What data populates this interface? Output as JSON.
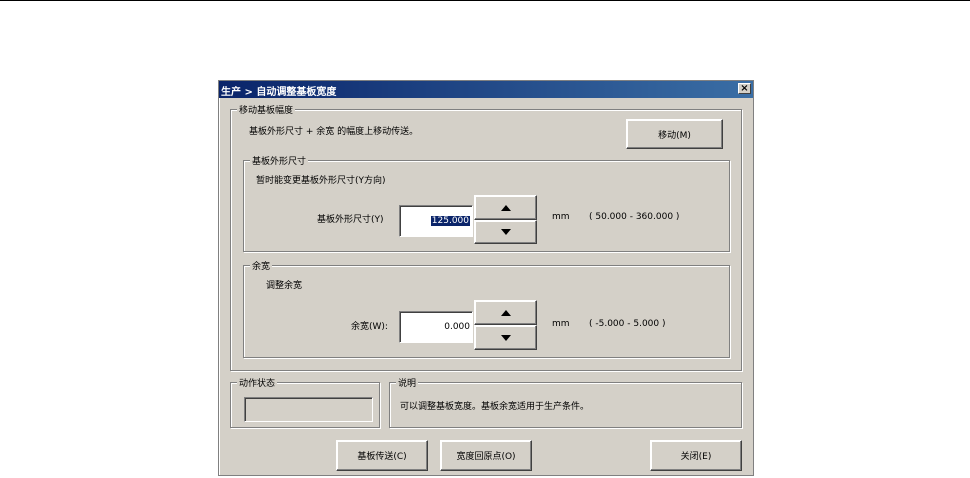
{
  "window": {
    "title": "生产 > 自动调整基板宽度",
    "close_glyph": "×"
  },
  "move_group": {
    "legend": "移动基板幅度",
    "description": "基板外形尺寸 + 余宽 的幅度上移动传送。",
    "move_button": "移动(M)"
  },
  "size_group": {
    "legend": "基板外形尺寸",
    "note": "暂时能变更基板外形尺寸(Y方向)",
    "field_label": "基板外形尺寸(Y)",
    "value": "125.000",
    "unit": "mm",
    "range": "( 50.000 - 360.000 )"
  },
  "margin_group": {
    "legend": "余宽",
    "note": "调整余宽",
    "field_label": "余宽(W):",
    "value": "0.000",
    "unit": "mm",
    "range": "( -5.000 - 5.000 )"
  },
  "status_group": {
    "legend": "动作状态",
    "value": ""
  },
  "explain_group": {
    "legend": "说明",
    "text": "可以调整基板宽度。基板余宽适用于生产条件。"
  },
  "buttons": {
    "transport": "基板传送(C)",
    "origin": "宽度回原点(O)",
    "close": "关闭(E)"
  }
}
